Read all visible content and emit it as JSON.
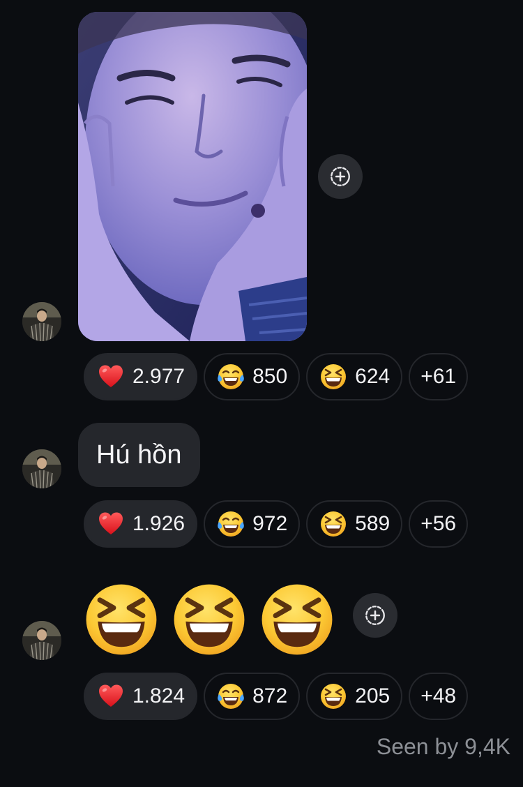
{
  "messages": [
    {
      "type": "image",
      "image_description": "selfie photo",
      "reactions": [
        {
          "emoji": "red-heart",
          "count": "2.977",
          "active": true
        },
        {
          "emoji": "face-with-tears-of-joy",
          "count": "850",
          "active": false
        },
        {
          "emoji": "grinning-squinting-face",
          "count": "624",
          "active": false
        },
        {
          "emoji": "more",
          "count": "+61",
          "active": false
        }
      ]
    },
    {
      "type": "text",
      "text": "Hú hồn",
      "reactions": [
        {
          "emoji": "red-heart",
          "count": "1.926",
          "active": true
        },
        {
          "emoji": "face-with-tears-of-joy",
          "count": "972",
          "active": false
        },
        {
          "emoji": "grinning-squinting-face",
          "count": "589",
          "active": false
        },
        {
          "emoji": "more",
          "count": "+56",
          "active": false
        }
      ]
    },
    {
      "type": "emoji",
      "emojis": [
        "grinning-squinting-face",
        "grinning-squinting-face",
        "grinning-squinting-face"
      ],
      "reactions": [
        {
          "emoji": "red-heart",
          "count": "1.824",
          "active": true
        },
        {
          "emoji": "face-with-tears-of-joy",
          "count": "872",
          "active": false
        },
        {
          "emoji": "grinning-squinting-face",
          "count": "205",
          "active": false
        },
        {
          "emoji": "more",
          "count": "+48",
          "active": false
        }
      ]
    }
  ],
  "seen_label": "Seen by 9,4K",
  "colors": {
    "background": "#0b0d11",
    "bubble": "#25272c",
    "secondary_text": "#8d9096"
  }
}
